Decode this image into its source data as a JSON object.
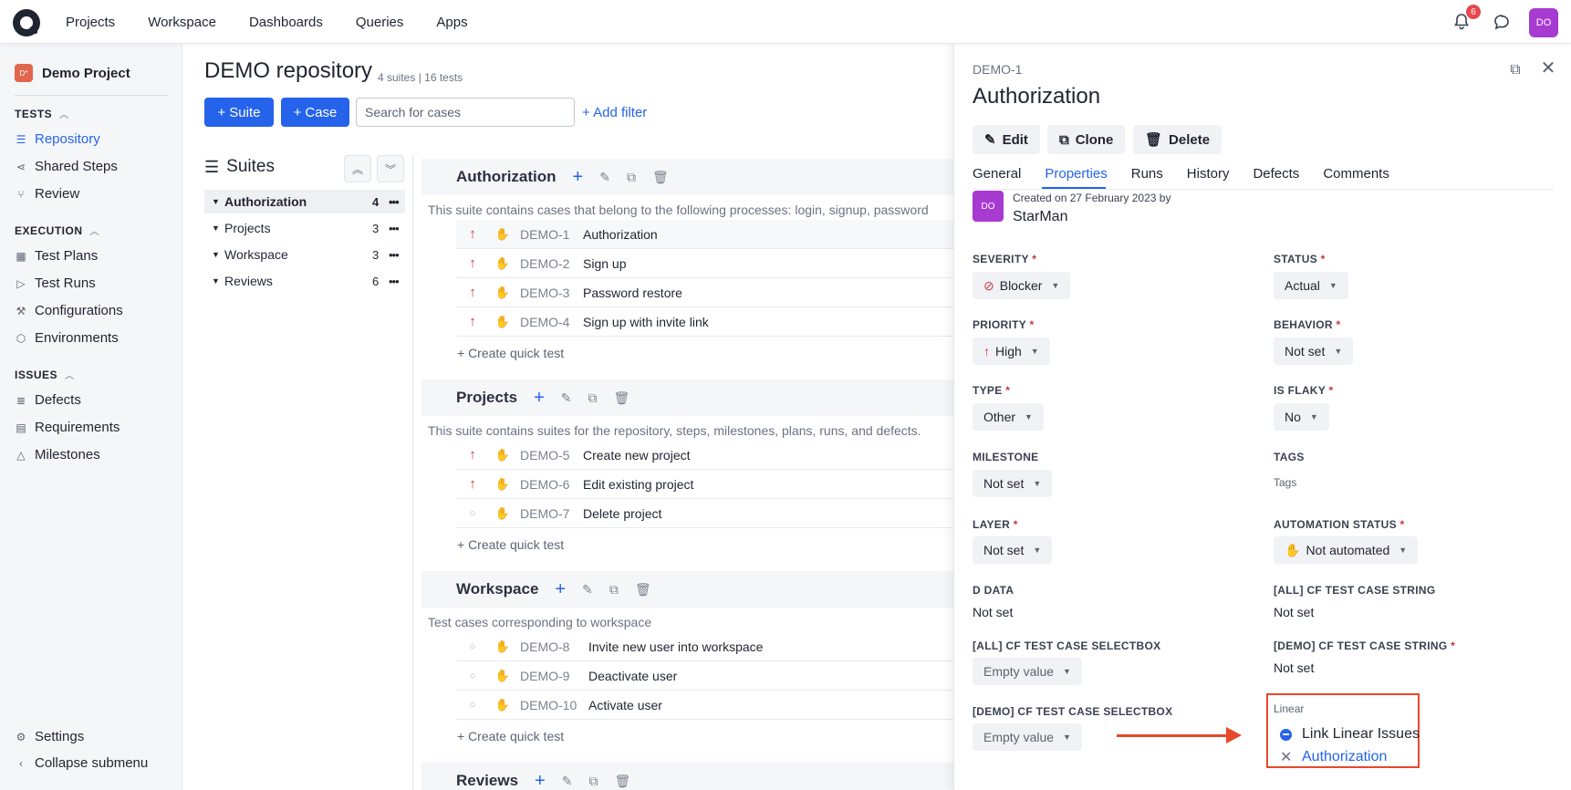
{
  "nav": {
    "links": [
      "Projects",
      "Workspace",
      "Dashboards",
      "Queries",
      "Apps"
    ],
    "notification_count": "6",
    "avatar": "DO"
  },
  "sidebar": {
    "project_icon": "D*",
    "project_name": "Demo Project",
    "sections": [
      {
        "title": "TESTS",
        "items": [
          {
            "label": "Repository",
            "icon": "list-tree-icon",
            "active": true
          },
          {
            "label": "Shared Steps",
            "icon": "share-icon"
          },
          {
            "label": "Review",
            "icon": "merge-icon"
          }
        ]
      },
      {
        "title": "EXECUTION",
        "items": [
          {
            "label": "Test Plans",
            "icon": "calendar-grid-icon"
          },
          {
            "label": "Test Runs",
            "icon": "play-icon"
          },
          {
            "label": "Configurations",
            "icon": "wrench-icon"
          },
          {
            "label": "Environments",
            "icon": "cube-icon"
          }
        ]
      },
      {
        "title": "ISSUES",
        "items": [
          {
            "label": "Defects",
            "icon": "server-icon"
          },
          {
            "label": "Requirements",
            "icon": "document-icon"
          },
          {
            "label": "Milestones",
            "icon": "triangle-icon"
          }
        ]
      }
    ],
    "settings": "Settings",
    "collapse": "Collapse submenu"
  },
  "repo": {
    "title": "DEMO repository",
    "subtitle": "4 suites | 16 tests",
    "suite_button": "Suite",
    "case_button": "Case",
    "search_placeholder": "Search for cases",
    "add_filter": "+ Add filter"
  },
  "tree": {
    "title": "Suites",
    "items": [
      {
        "name": "Authorization",
        "count": "4",
        "selected": true
      },
      {
        "name": "Projects",
        "count": "3"
      },
      {
        "name": "Workspace",
        "count": "3"
      },
      {
        "name": "Reviews",
        "count": "6"
      }
    ]
  },
  "suites": [
    {
      "name": "Authorization",
      "description": "This suite contains cases that belong to the following processes: login, signup, password",
      "cases": [
        {
          "id": "DEMO-1",
          "title": "Authorization",
          "priority": "high"
        },
        {
          "id": "DEMO-2",
          "title": "Sign up",
          "priority": "high"
        },
        {
          "id": "DEMO-3",
          "title": "Password restore",
          "priority": "high"
        },
        {
          "id": "DEMO-4",
          "title": "Sign up with invite link",
          "priority": "high"
        }
      ]
    },
    {
      "name": "Projects",
      "description": "This suite contains suites for the repository, steps, milestones, plans, runs, and defects.",
      "cases": [
        {
          "id": "DEMO-5",
          "title": "Create new project",
          "priority": "high"
        },
        {
          "id": "DEMO-6",
          "title": "Edit existing project",
          "priority": "high"
        },
        {
          "id": "DEMO-7",
          "title": "Delete project",
          "priority": "none"
        }
      ]
    },
    {
      "name": "Workspace",
      "description": "Test cases corresponding to workspace",
      "cases": [
        {
          "id": "DEMO-8",
          "title": "Invite new user into workspace",
          "priority": "none"
        },
        {
          "id": "DEMO-9",
          "title": "Deactivate user",
          "priority": "none"
        },
        {
          "id": "DEMO-10",
          "title": "Activate user",
          "priority": "none"
        }
      ]
    },
    {
      "name": "Reviews",
      "description": "",
      "cases": []
    }
  ],
  "quick_test": "+ Create quick test",
  "panel": {
    "case_id": "DEMO-1",
    "title": "Authorization",
    "edit": "Edit",
    "clone": "Clone",
    "delete": "Delete",
    "tabs": [
      "General",
      "Properties",
      "Runs",
      "History",
      "Defects",
      "Comments"
    ],
    "avatar": "DO",
    "created": "Created on 27 February 2023 by",
    "author": "StarMan",
    "fields": {
      "severity": {
        "label": "SEVERITY",
        "value": "Blocker"
      },
      "status": {
        "label": "STATUS",
        "value": "Actual"
      },
      "priority": {
        "label": "PRIORITY",
        "value": "High"
      },
      "behavior": {
        "label": "BEHAVIOR",
        "value": "Not set"
      },
      "type": {
        "label": "TYPE",
        "value": "Other"
      },
      "is_flaky": {
        "label": "IS FLAKY",
        "value": "No"
      },
      "milestone": {
        "label": "MILESTONE",
        "value": "Not set"
      },
      "tags": {
        "label": "TAGS",
        "value": "Tags"
      },
      "layer": {
        "label": "LAYER",
        "value": "Not set"
      },
      "automation": {
        "label": "AUTOMATION STATUS",
        "value": "Not automated"
      },
      "d_data": {
        "label": "D DATA",
        "value": "Not set"
      },
      "all_string": {
        "label": "[ALL] CF TEST CASE STRING",
        "value": "Not set"
      },
      "all_select": {
        "label": "[ALL] CF TEST CASE SELECTBOX",
        "value": "Empty value"
      },
      "demo_string": {
        "label": "[DEMO] CF TEST CASE STRING",
        "value": "Not set"
      },
      "demo_select": {
        "label": "[DEMO] CF TEST CASE SELECTBOX",
        "value": "Empty value"
      }
    },
    "required_mark": "*",
    "linear": {
      "label": "Linear",
      "link_label": "Link Linear Issues",
      "linked_issue": "Authorization"
    }
  },
  "colors": {
    "accent": "#2563eb",
    "high_priority": "#c7353a",
    "highlight": "#e8482a",
    "avatar": "#a73ad0"
  }
}
